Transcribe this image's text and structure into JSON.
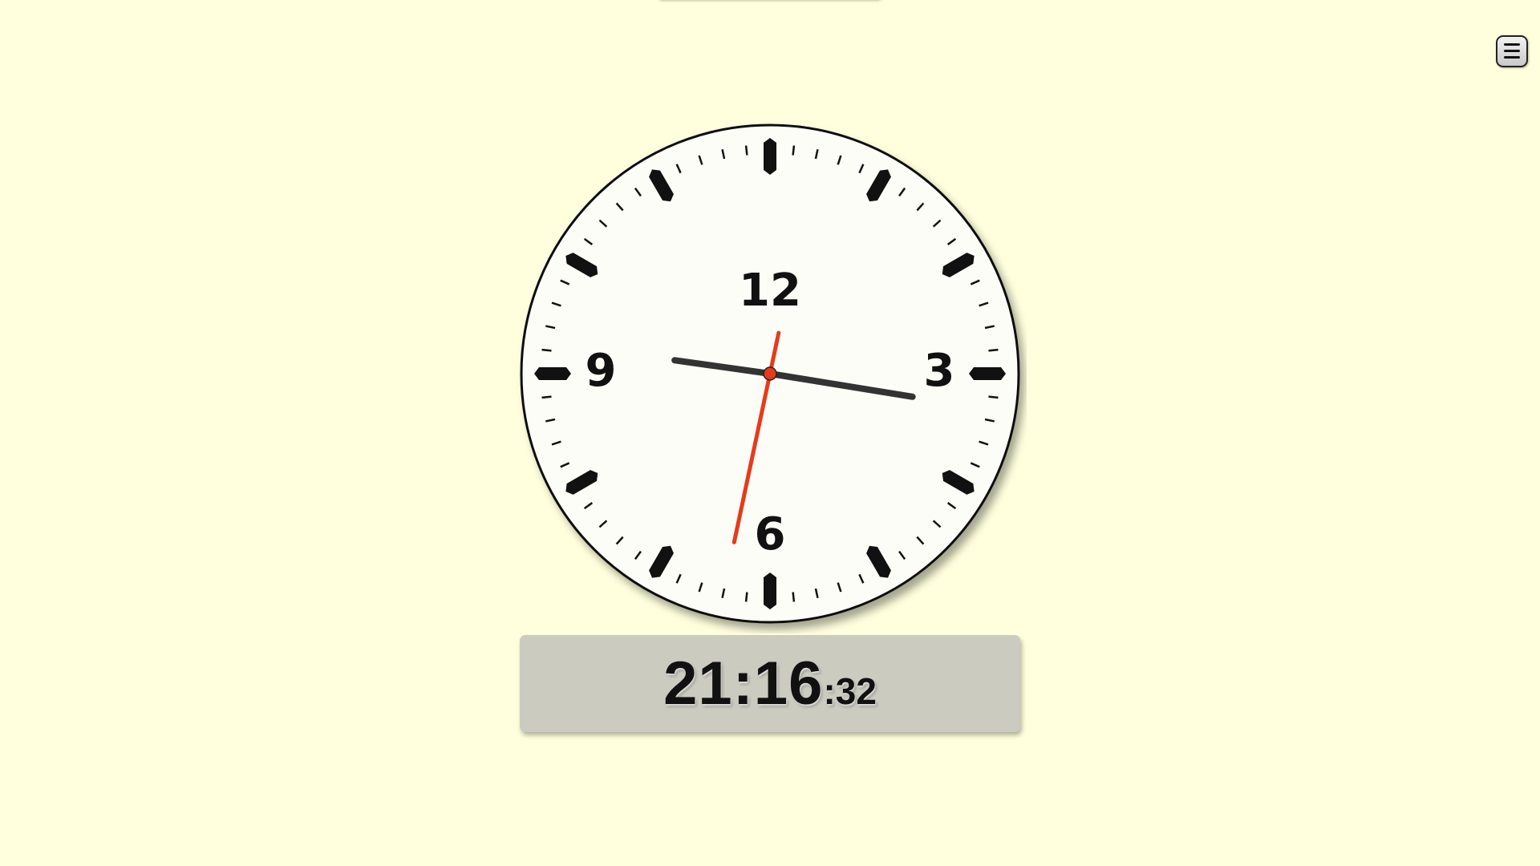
{
  "clock": {
    "numerals": [
      "12",
      "3",
      "6",
      "9"
    ],
    "time": {
      "hours": 21,
      "minutes": 16,
      "seconds": 32
    },
    "colors": {
      "face": "#fdfdf8",
      "rim": "#111111",
      "marks": "#111111",
      "hands": "#333333",
      "second_hand": "#e63b1a"
    }
  },
  "digital": {
    "time_main": "21:16",
    "time_seconds": ":32"
  },
  "menu": {
    "icon": "hamburger-menu-icon"
  },
  "colors": {
    "background": "#ffffdd",
    "panel": "#cbcbc0"
  }
}
